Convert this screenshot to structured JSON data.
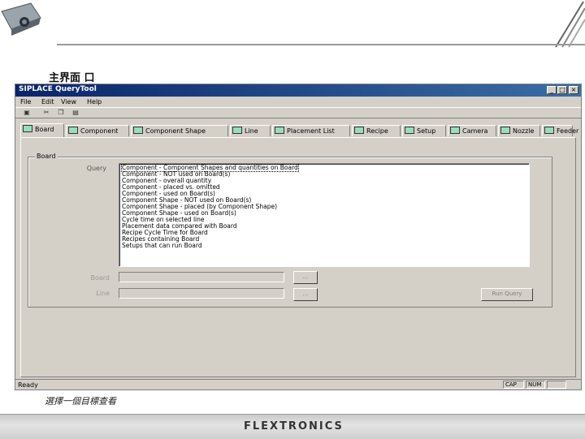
{
  "slide": {
    "title": "主界面 口",
    "caption": "選擇一個目標查看",
    "logo": "FLEXTRONICS"
  },
  "window": {
    "title": "SIPLACE QueryTool",
    "controls": [
      "_",
      "□",
      "×"
    ]
  },
  "menu": [
    "File",
    "Edit",
    "View",
    "Help"
  ],
  "toolbar_icons": [
    "save-icon",
    "cut-icon",
    "copy-icon",
    "paste-icon"
  ],
  "tabs": [
    {
      "label": "Board",
      "active": true
    },
    {
      "label": "Component"
    },
    {
      "label": "Component Shape"
    },
    {
      "label": "Line"
    },
    {
      "label": "Placement List"
    },
    {
      "label": "Recipe"
    },
    {
      "label": "Setup"
    },
    {
      "label": "Camera"
    },
    {
      "label": "Nozzle"
    },
    {
      "label": "Feeder"
    }
  ],
  "group": {
    "label": "Board",
    "query_label": "Query",
    "board_label": "Board",
    "line_label": "Line",
    "browse_label": "...",
    "run_label": "Run Query"
  },
  "queries": [
    "Component - Component Shapes and quantities on Board",
    "Component - NOT used on Board(s)",
    "Component - overall quantity",
    "Component - placed vs. omitted",
    "Component - used on Board(s)",
    "Component Shape - NOT used on Board(s)",
    "Component Shape - placed (by Component Shape)",
    "Component Shape - used on Board(s)",
    "Cycle time on selected line",
    "Placement data compared with Board",
    "Recipe Cycle Time for Board",
    "Recipes containing Board",
    "Setups that can run Board"
  ],
  "status": {
    "text": "Ready",
    "cap": "CAP",
    "num": "NUM"
  },
  "colors": {
    "titlebar": "#0a246a",
    "window_bg": "#d4d0c8"
  }
}
